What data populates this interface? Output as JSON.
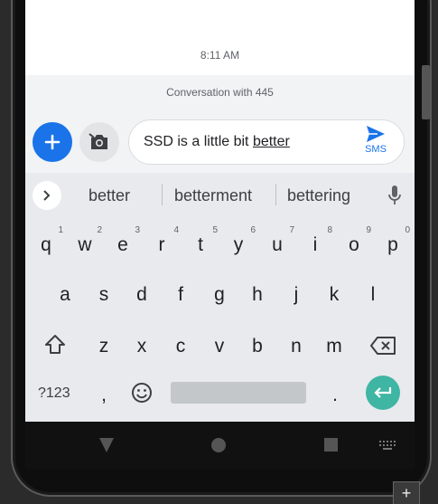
{
  "messages": {
    "timestamp": "8:11 AM",
    "conversation_label": "Conversation with 445"
  },
  "compose": {
    "text_before": "SSD is a little bit ",
    "text_underlined": "better",
    "send_label": "SMS"
  },
  "suggestions": [
    "better",
    "betterment",
    "bettering"
  ],
  "keyboard": {
    "row1": [
      {
        "k": "q",
        "n": "1"
      },
      {
        "k": "w",
        "n": "2"
      },
      {
        "k": "e",
        "n": "3"
      },
      {
        "k": "r",
        "n": "4"
      },
      {
        "k": "t",
        "n": "5"
      },
      {
        "k": "y",
        "n": "6"
      },
      {
        "k": "u",
        "n": "7"
      },
      {
        "k": "i",
        "n": "8"
      },
      {
        "k": "o",
        "n": "9"
      },
      {
        "k": "p",
        "n": "0"
      }
    ],
    "row2": [
      "a",
      "s",
      "d",
      "f",
      "g",
      "h",
      "j",
      "k",
      "l"
    ],
    "row3": [
      "z",
      "x",
      "c",
      "v",
      "b",
      "n",
      "m"
    ],
    "symbols_label": "?123",
    "comma": ",",
    "period": "."
  },
  "colors": {
    "accent": "#1a73e8",
    "enter": "#3fb5a3"
  },
  "icons": [
    "plus-icon",
    "camera-icon",
    "send-icon",
    "chevron-right-icon",
    "mic-icon",
    "shift-icon",
    "backspace-icon",
    "emoji-icon",
    "enter-icon",
    "back-icon",
    "home-icon",
    "recents-icon",
    "keyboard-icon"
  ],
  "corner_button": "+"
}
